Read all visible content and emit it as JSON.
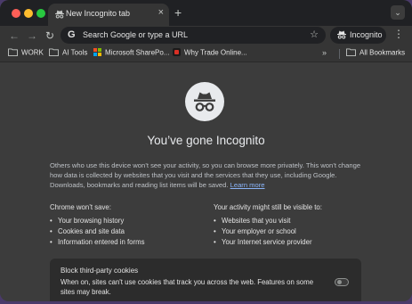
{
  "tabs": {
    "active_title": "New Incognito tab",
    "close_glyph": "×",
    "new_tab_glyph": "+",
    "search_tabs_glyph": "⌄"
  },
  "toolbar": {
    "back_glyph": "←",
    "forward_glyph": "→",
    "reload_glyph": "↻",
    "omnibox_placeholder": "Search Google or type a URL",
    "google_glyph": "G",
    "star_glyph": "☆",
    "incognito_label": "Incognito",
    "menu_glyph": "⋮"
  },
  "bookmarks": {
    "items": [
      {
        "label": "WORK",
        "icon": "folder-icon"
      },
      {
        "label": "AI Tools",
        "icon": "folder-icon"
      },
      {
        "label": "Microsoft SharePo...",
        "icon": "microsoft-icon"
      },
      {
        "label": "Why Trade Online...",
        "icon": "site-favicon-icon"
      }
    ],
    "overflow_glyph": "»",
    "all_bookmarks_label": "All Bookmarks"
  },
  "page": {
    "heading": "You’ve gone Incognito",
    "intro": "Others who use this device won’t see your activity, so you can browse more privately. This won’t change how data is collected by websites that you visit and the services that they use, including Google. Downloads, bookmarks and reading list items will be saved.",
    "learn_more": "Learn more",
    "wont_save_title": "Chrome won’t save:",
    "wont_save_items": [
      "Your browsing history",
      "Cookies and site data",
      "Information entered in forms"
    ],
    "visible_title": "Your activity might still be visible to:",
    "visible_items": [
      "Websites that you visit",
      "Your employer or school",
      "Your Internet service provider"
    ],
    "cookies_title": "Block third-party cookies",
    "cookies_desc": "When on, sites can't use cookies that track you across the web. Features on some sites may break.",
    "cookies_toggle_on": false
  },
  "colors": {
    "link": "#8ab4f8",
    "background": "#3c3c3c",
    "tabstrip": "#202124"
  }
}
